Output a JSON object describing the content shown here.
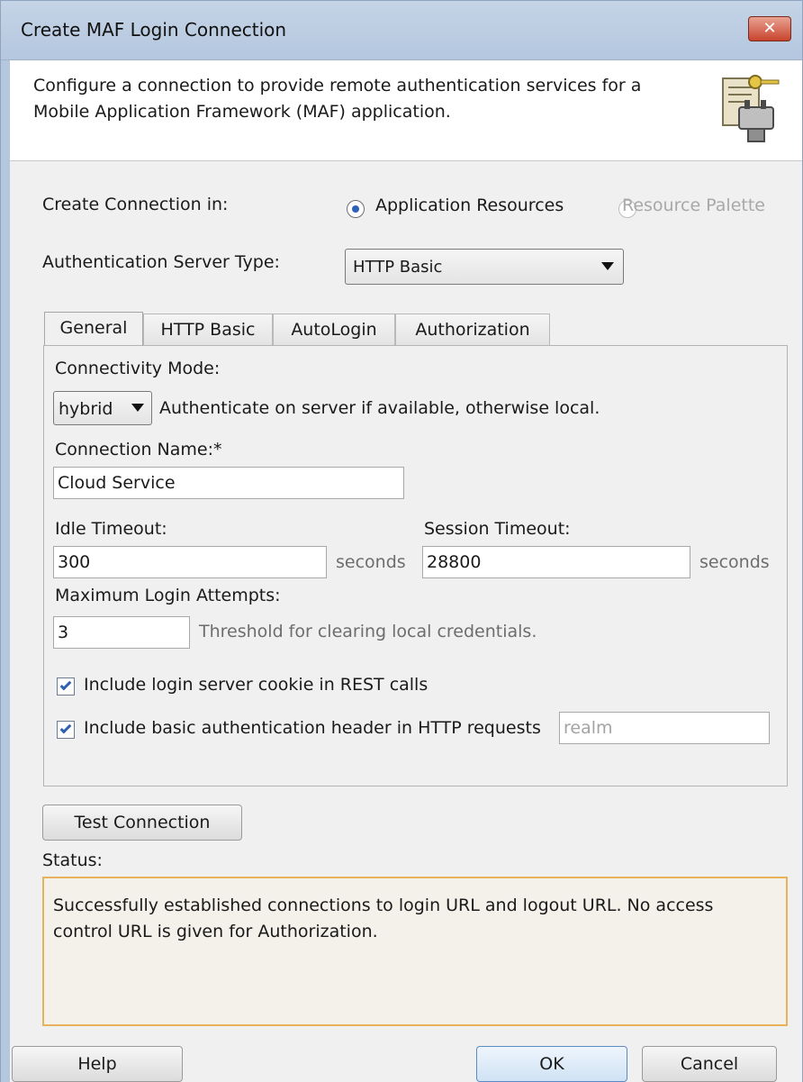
{
  "window": {
    "title": "Create MAF Login Connection",
    "close_label": "✕"
  },
  "header": {
    "description": "Configure a connection to provide remote authentication services for a Mobile Application Framework (MAF) application."
  },
  "form": {
    "create_in_label": "Create Connection in:",
    "radio_app_resources": "Application Resources",
    "radio_resource_palette": "Resource Palette",
    "auth_server_type_label": "Authentication Server Type:",
    "auth_server_type_value": "HTTP Basic"
  },
  "tabs": [
    {
      "label": "General"
    },
    {
      "label": "HTTP Basic"
    },
    {
      "label": "AutoLogin"
    },
    {
      "label": "Authorization"
    }
  ],
  "general": {
    "connectivity_mode_label": "Connectivity Mode:",
    "connectivity_mode_value": "hybrid",
    "connectivity_mode_hint": "Authenticate on server if available, otherwise local.",
    "connection_name_label": "Connection Name:*",
    "connection_name_value": "Cloud Service",
    "idle_timeout_label": "Idle Timeout:",
    "idle_timeout_value": "300",
    "idle_timeout_unit": "seconds",
    "session_timeout_label": "Session Timeout:",
    "session_timeout_value": "28800",
    "session_timeout_unit": "seconds",
    "max_login_label": "Maximum Login Attempts:",
    "max_login_value": "3",
    "max_login_hint": "Threshold for clearing local credentials.",
    "include_cookie_label": "Include login server cookie in REST calls",
    "include_basic_auth_label": "Include basic authentication header in HTTP requests",
    "realm_placeholder": "realm"
  },
  "actions": {
    "test_connection_label": "Test Connection",
    "status_label": "Status:",
    "status_text": "Successfully established connections to login URL and logout URL. No access control URL is given for Authorization.",
    "help_label": "Help",
    "ok_label": "OK",
    "cancel_label": "Cancel"
  },
  "colors": {
    "title_bar": "#b4c7df",
    "close_button": "#c8442d",
    "status_border": "#e8b25a",
    "checkbox_tick": "#2f5fb0"
  },
  "icons": {
    "header": "connection-key-plug-icon"
  }
}
